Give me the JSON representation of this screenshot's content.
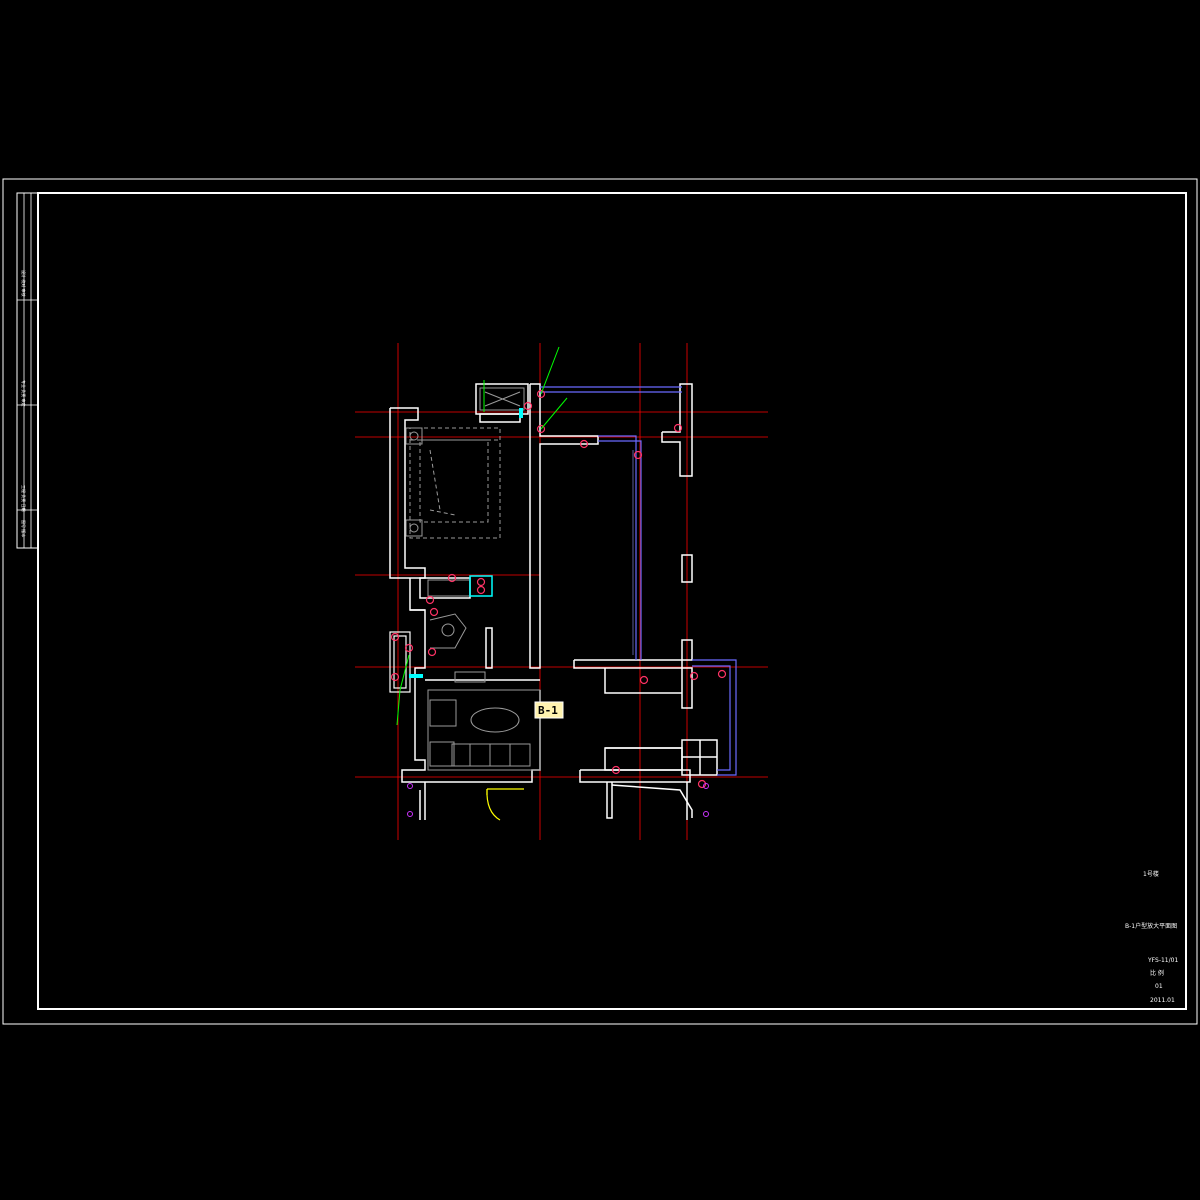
{
  "title_block": {
    "building": "1号楼",
    "drawing_title": "B-1户型放大平面图",
    "drawing_no": "YFS-11/01",
    "scale_label": "比 例",
    "sheet_no": "01",
    "date": "2011.01"
  },
  "room_tag": {
    "label": "B-1"
  },
  "side_strip": {
    "block1": "设计 校对 审核",
    "block2": "专业 负责 审定",
    "block3": "工程 负责 日期",
    "block4": "图号 版本"
  },
  "colors": {
    "background": "#000000",
    "border": "#ffffff",
    "axis": "#ff0000",
    "wall": "#ffffff",
    "window": "#6a6aff",
    "furniture": "#9a9a9a",
    "marker": "#ff3366",
    "leader": "#00ff00",
    "door": "#ffff00",
    "fixture": "#00ffff",
    "tag_fill": "#fff3b0"
  }
}
